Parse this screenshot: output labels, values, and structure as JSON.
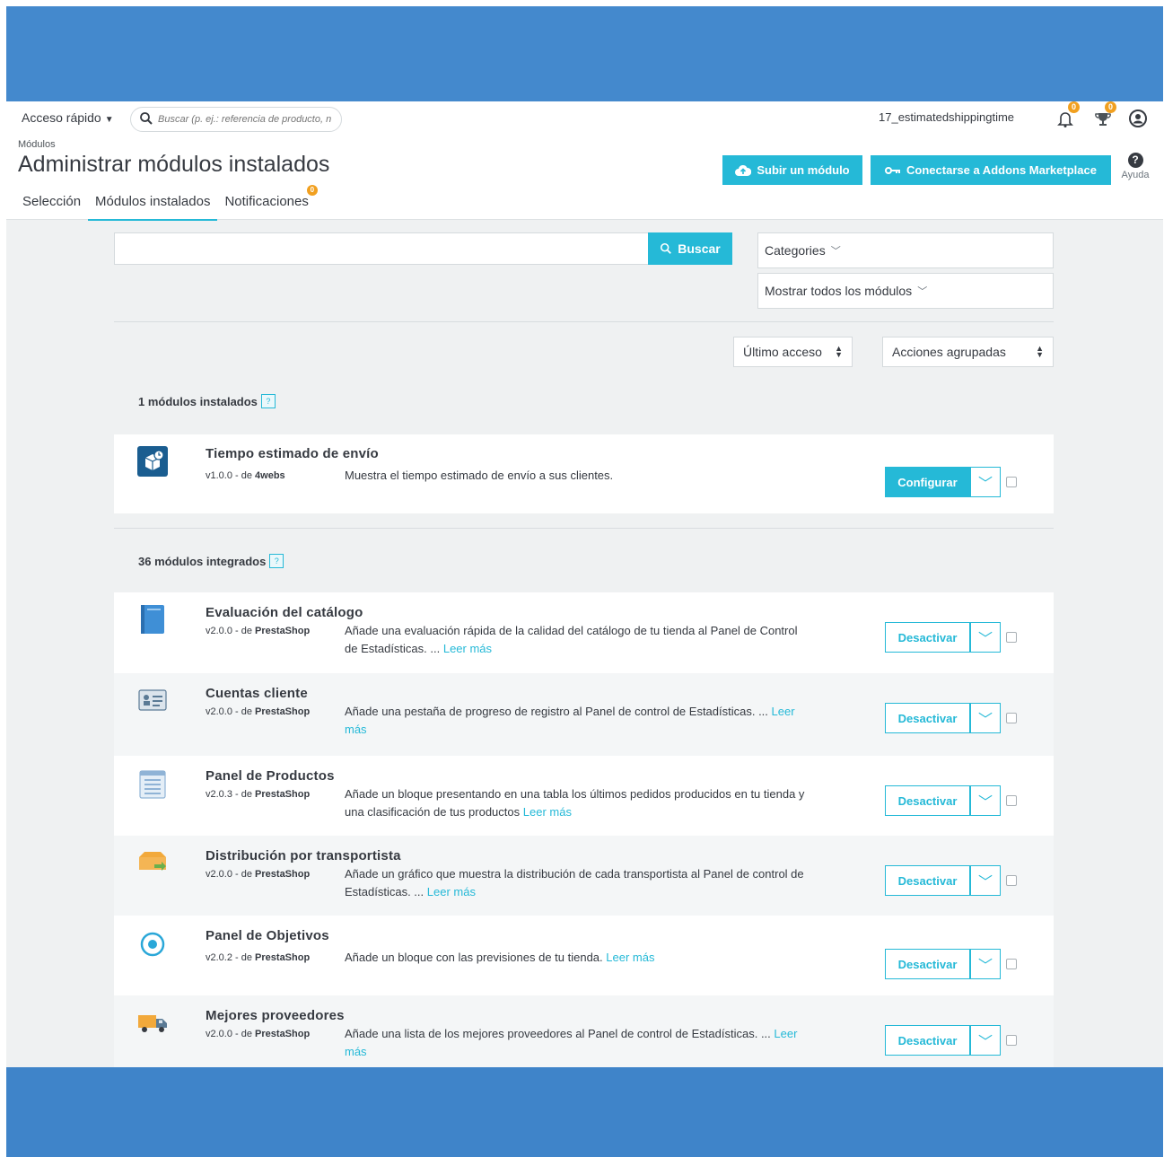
{
  "header": {
    "quick_access": "Acceso rápido",
    "search_placeholder": "Buscar (p. ej.: referencia de producto, n",
    "shop_name": "17_estimatedshippingtime",
    "notif_badge_1": "0",
    "notif_badge_2": "0"
  },
  "page": {
    "breadcrumb": "Módulos",
    "title": "Administrar módulos instalados",
    "upload_button": "Subir un módulo",
    "connect_button": "Conectarse a Addons Marketplace",
    "help_label": "Ayuda",
    "tabs": [
      "Selección",
      "Módulos instalados",
      "Notificaciones"
    ],
    "tab_badge": "0"
  },
  "filters": {
    "search_button": "Buscar",
    "categories": "Categories",
    "show_all": "Mostrar todos los módulos",
    "sort": "Último acceso",
    "bulk": "Acciones agrupadas"
  },
  "installed": {
    "title": "1 módulos instalados",
    "help": "?",
    "modules": [
      {
        "name": "Tiempo estimado de envío",
        "version": "v1.0.0 - de",
        "author": "4webs",
        "description": "Muestra el tiempo estimado de envío a sus clientes.",
        "action": "Configurar"
      }
    ]
  },
  "builtin": {
    "title": "36 módulos integrados",
    "help": "?",
    "read_more": "Leer más",
    "action": "Desactivar",
    "modules": [
      {
        "name": "Evaluación del catálogo",
        "version": "v2.0.0 - de",
        "author": "PrestaShop",
        "description": "Añade una evaluación rápida de la calidad del catálogo de tu tienda al Panel de Control de Estadísticas. ..."
      },
      {
        "name": "Cuentas cliente",
        "version": "v2.0.0 - de",
        "author": "PrestaShop",
        "description": "Añade una pestaña de progreso de registro al Panel de control de Estadísticas. ..."
      },
      {
        "name": "Panel de Productos",
        "version": "v2.0.3 - de",
        "author": "PrestaShop",
        "description": "Añade un bloque presentando en una tabla los últimos pedidos producidos en tu tienda y una clasificación de tus productos"
      },
      {
        "name": "Distribución por transportista",
        "version": "v2.0.0 - de",
        "author": "PrestaShop",
        "description": "Añade un gráfico que muestra la distribución de cada transportista al Panel de control de Estadísticas. ..."
      },
      {
        "name": "Panel de Objetivos",
        "version": "v2.0.2 - de",
        "author": "PrestaShop",
        "description": "Añade un bloque con las previsiones de tu tienda."
      },
      {
        "name": "Mejores proveedores",
        "version": "v2.0.0 - de",
        "author": "PrestaShop",
        "description": "Añade una lista de los mejores proveedores al Panel de control de Estadísticas. ..."
      }
    ]
  },
  "colors": {
    "frame": "#4489cd",
    "accent": "#25b9d7",
    "badge": "#f1a020"
  }
}
